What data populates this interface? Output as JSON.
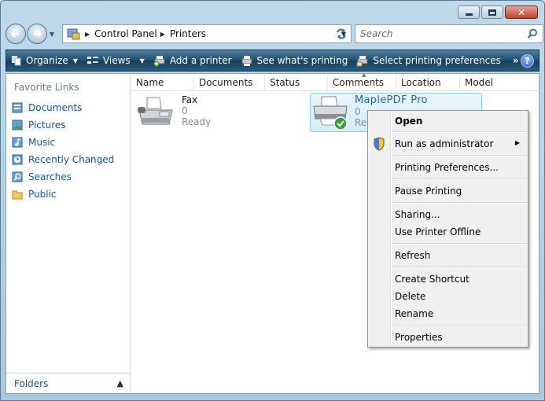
{
  "window": {
    "buttons": {
      "minimize": "minimize",
      "maximize": "maximize",
      "close": "✕"
    }
  },
  "address": {
    "breadcrumb": [
      "Control Panel",
      "Printers"
    ]
  },
  "search": {
    "placeholder": "Search"
  },
  "toolbar": {
    "organize": "Organize",
    "views": "Views",
    "add_printer": "Add a printer",
    "see_printing": "See what's printing",
    "select_prefs": "Select printing preferences",
    "more": "»",
    "help": "?"
  },
  "sidebar": {
    "title": "Favorite Links",
    "items": [
      {
        "label": "Documents",
        "icon": "documents-icon"
      },
      {
        "label": "Pictures",
        "icon": "pictures-icon"
      },
      {
        "label": "Music",
        "icon": "music-icon"
      },
      {
        "label": "Recently Changed",
        "icon": "recently-changed-icon"
      },
      {
        "label": "Searches",
        "icon": "searches-icon"
      },
      {
        "label": "Public",
        "icon": "public-folder-icon"
      }
    ],
    "folders": "Folders"
  },
  "columns": [
    "Name",
    "Documents",
    "Status",
    "Comments",
    "Location",
    "Model"
  ],
  "printers": [
    {
      "name": "Fax",
      "documents": "0",
      "status": "Ready",
      "selected": false
    },
    {
      "name": "MaplePDF Pro",
      "documents": "0",
      "status": "Rea",
      "selected": true,
      "default": true
    }
  ],
  "context_menu": {
    "open": "Open",
    "run_as_admin": "Run as administrator",
    "printing_prefs": "Printing Preferences...",
    "pause": "Pause Printing",
    "sharing": "Sharing...",
    "offline": "Use Printer Offline",
    "refresh": "Refresh",
    "shortcut": "Create Shortcut",
    "delete": "Delete",
    "rename": "Rename",
    "properties": "Properties"
  },
  "colors": {
    "accent": "#1a55a5",
    "cmdbar": "#1f4e6c",
    "selection": "#d4edfb"
  }
}
